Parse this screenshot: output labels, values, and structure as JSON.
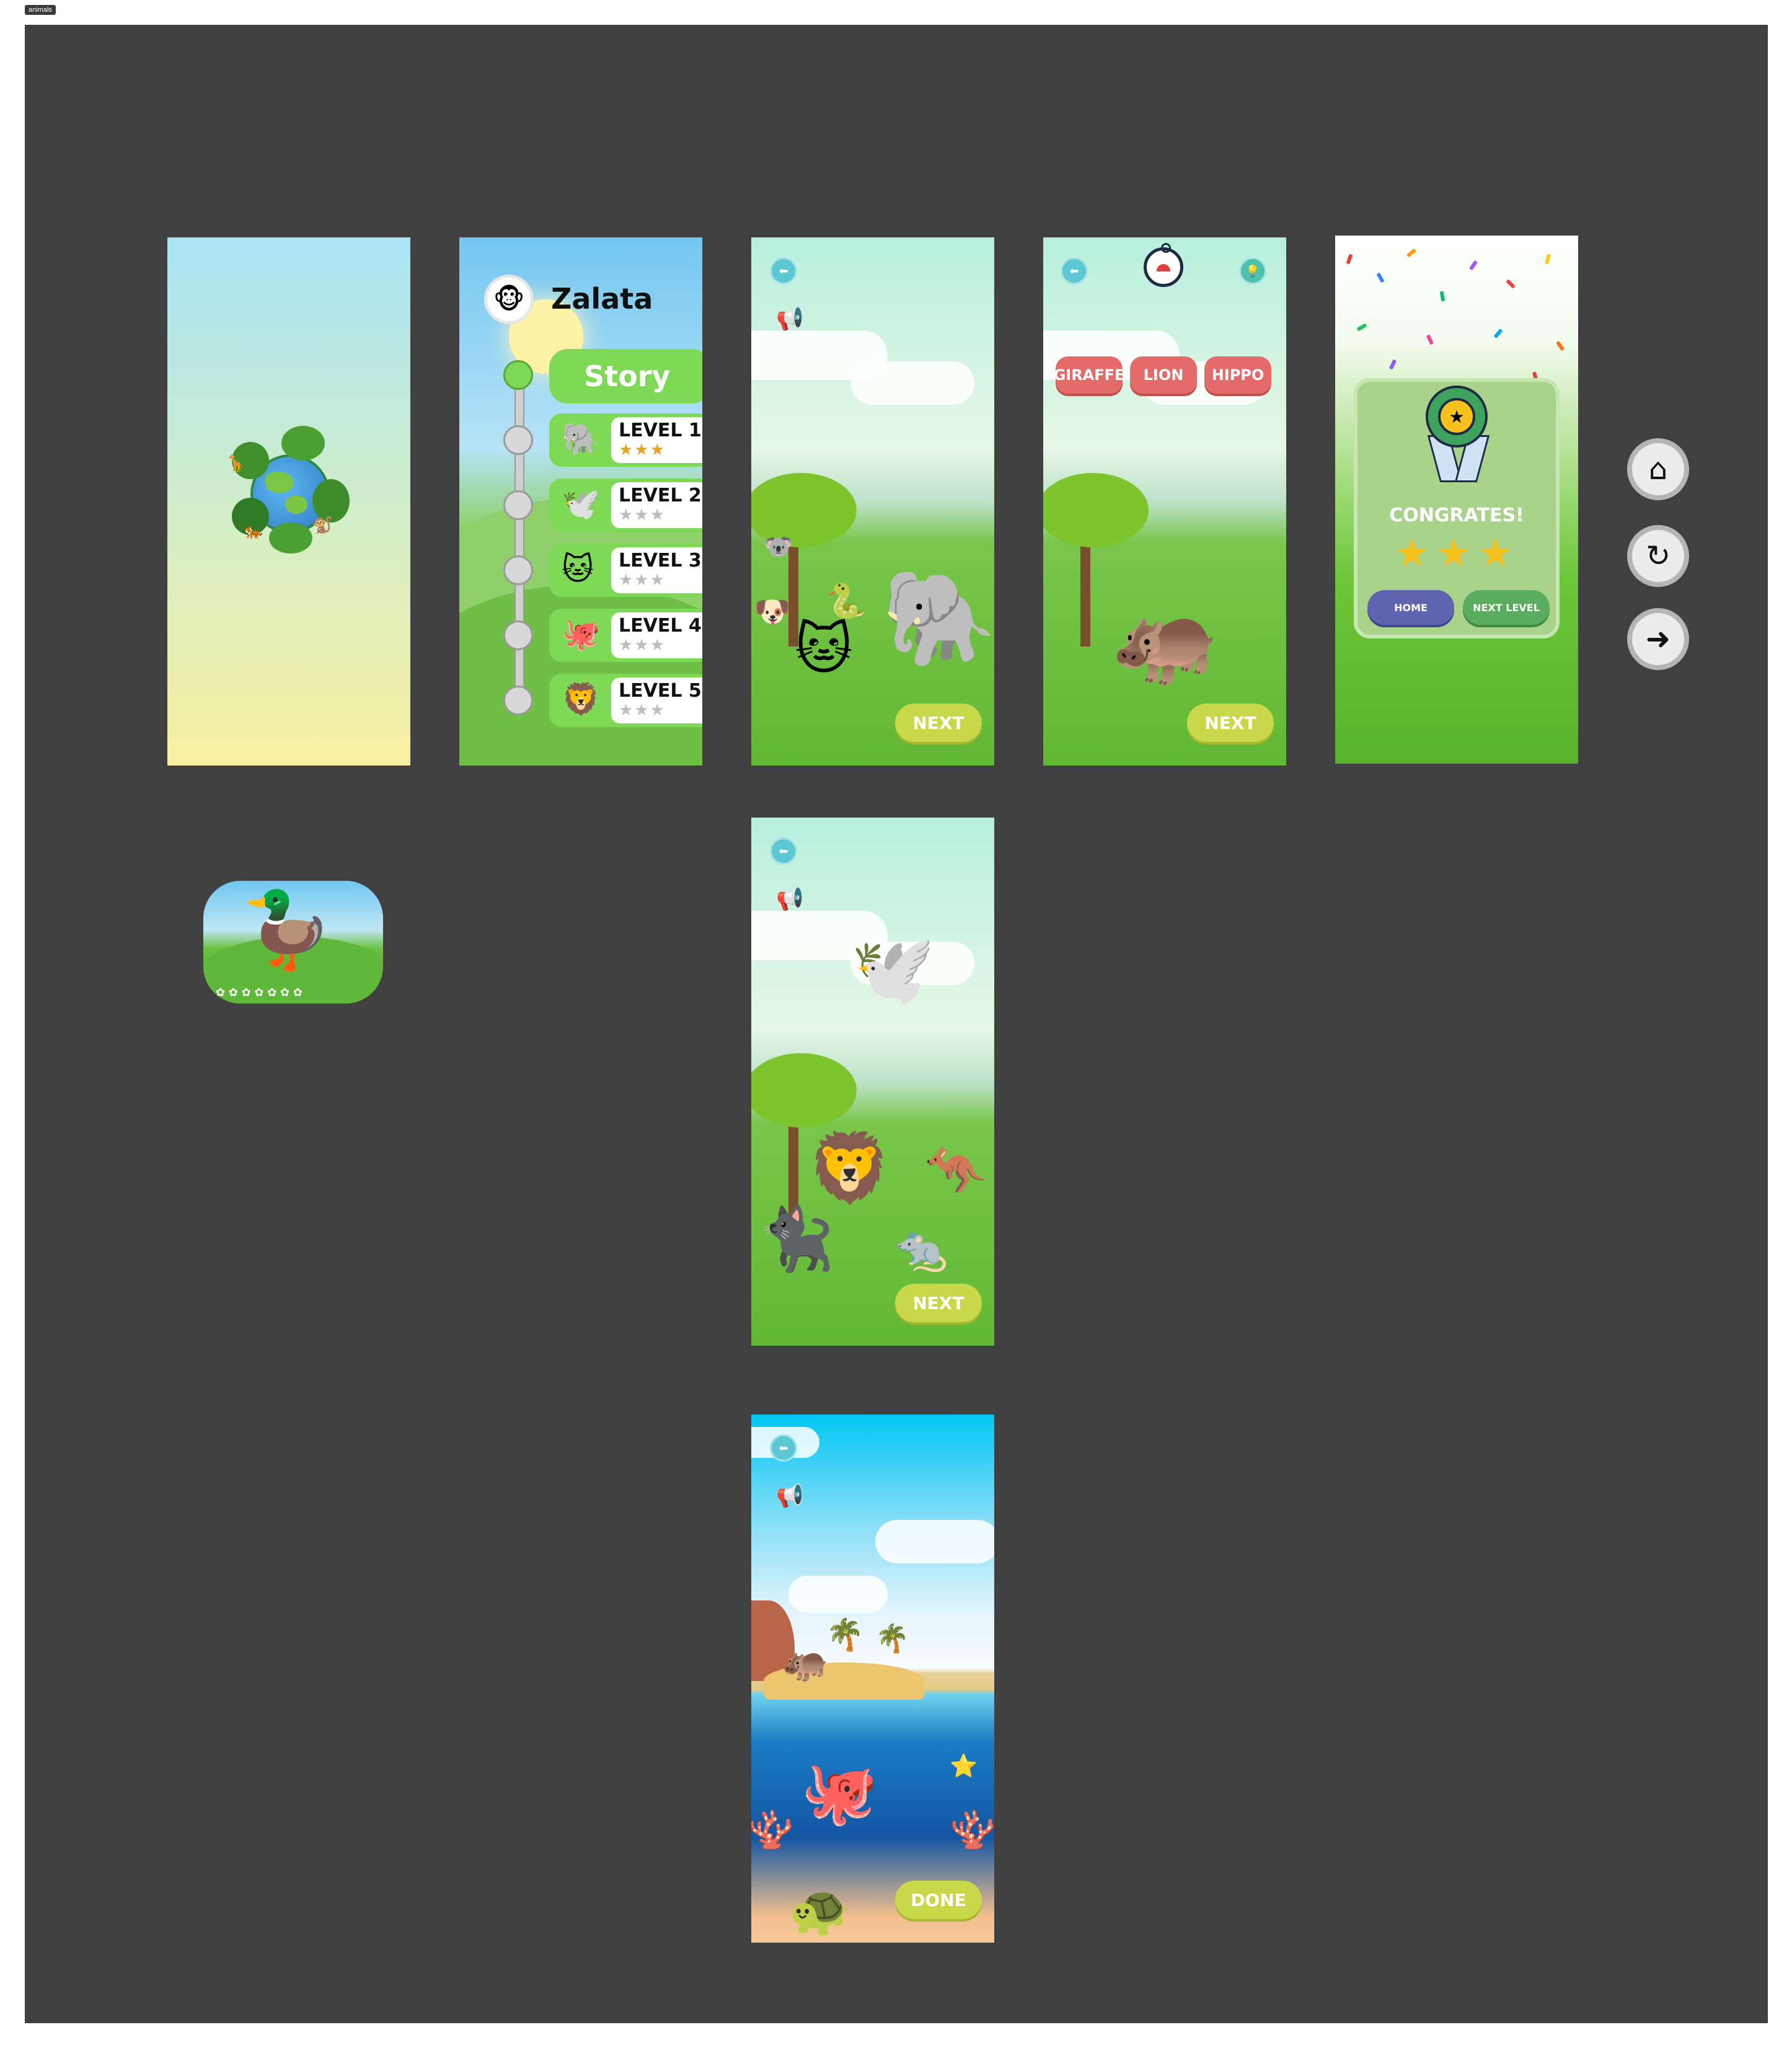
{
  "frame": {
    "label": "animals"
  },
  "menu": {
    "title": "Zalata",
    "story_button": "Story",
    "levels": [
      {
        "label": "LEVEL 1",
        "stars": "★★★",
        "icon": "elephant-icon",
        "glyph": "🐘"
      },
      {
        "label": "LEVEL 2",
        "stars": "★★★",
        "icon": "pelican-icon",
        "glyph": "🕊️"
      },
      {
        "label": "LEVEL 3",
        "stars": "★★★",
        "icon": "cat-icon",
        "glyph": "🐱"
      },
      {
        "label": "LEVEL 4",
        "stars": "★★★",
        "icon": "octopus-icon",
        "glyph": "🐙"
      },
      {
        "label": "LEVEL 5",
        "stars": "★★★",
        "icon": "lion-icon",
        "glyph": "🦁"
      }
    ]
  },
  "game1": {
    "next": "NEXT"
  },
  "quiz": {
    "answers": [
      "GIRAFFE",
      "LION",
      "HIPPO"
    ],
    "next": "NEXT"
  },
  "congrats": {
    "title": "CONGRATES!",
    "stars": "★★★",
    "home": "HOME",
    "next_level": "NEXT LEVEL"
  },
  "game2": {
    "next": "NEXT"
  },
  "sea": {
    "done": "DONE"
  },
  "colors": {
    "canvas": "#404040",
    "next_button": "#c8d848",
    "answer_button": "#e56b6b",
    "home_button": "#5f63b0",
    "next_level_button": "#5aad5e"
  }
}
